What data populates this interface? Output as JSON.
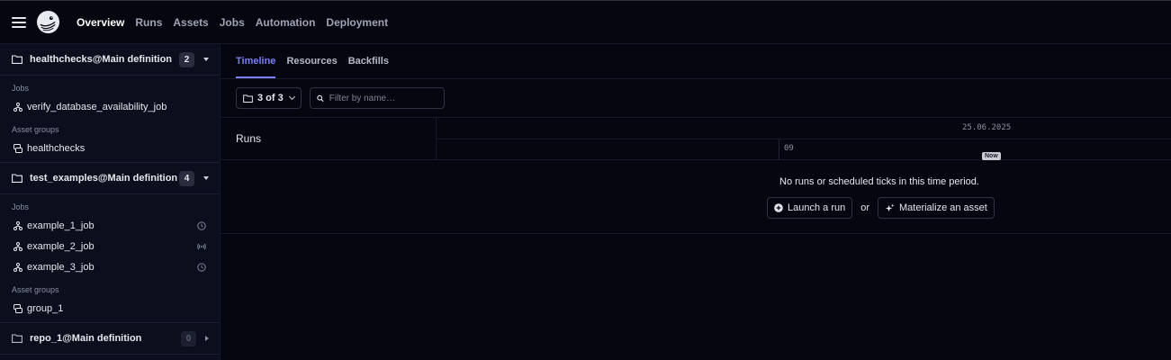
{
  "nav": {
    "items": [
      "Overview",
      "Runs",
      "Assets",
      "Jobs",
      "Automation",
      "Deployment"
    ],
    "active": "Overview"
  },
  "sidebar": {
    "repos": [
      {
        "name": "healthchecks@Main definition",
        "count": "2",
        "expanded": true,
        "jobs_label": "Jobs",
        "jobs": [
          {
            "label": "verify_database_availability_job",
            "status": ""
          }
        ],
        "groups_label": "Asset groups",
        "groups": [
          {
            "label": "healthchecks"
          }
        ]
      },
      {
        "name": "test_examples@Main definition",
        "count": "4",
        "expanded": true,
        "jobs_label": "Jobs",
        "jobs": [
          {
            "label": "example_1_job",
            "status": "clock-icon"
          },
          {
            "label": "example_2_job",
            "status": "sensor-icon"
          },
          {
            "label": "example_3_job",
            "status": "clock-icon"
          }
        ],
        "groups_label": "Asset groups",
        "groups": [
          {
            "label": "group_1"
          }
        ]
      },
      {
        "name": "repo_1@Main definition",
        "count": "0",
        "expanded": false
      }
    ]
  },
  "tabs": [
    {
      "label": "Timeline",
      "active": true
    },
    {
      "label": "Resources",
      "active": false
    },
    {
      "label": "Backfills",
      "active": false
    }
  ],
  "toolbar": {
    "repo_filter": "3 of 3",
    "search_placeholder": "Filter by name…"
  },
  "timeline": {
    "runs_label": "Runs",
    "date": "25.06.2025",
    "hour": "09",
    "now_label": "Now",
    "empty_message": "No runs or scheduled ticks in this time period.",
    "launch_run": "Launch a run",
    "or": "or",
    "materialize": "Materialize an asset"
  },
  "colors": {
    "accent": "#7b7ff5",
    "background": "#05060f",
    "sidebar": "#0b0e1c"
  }
}
